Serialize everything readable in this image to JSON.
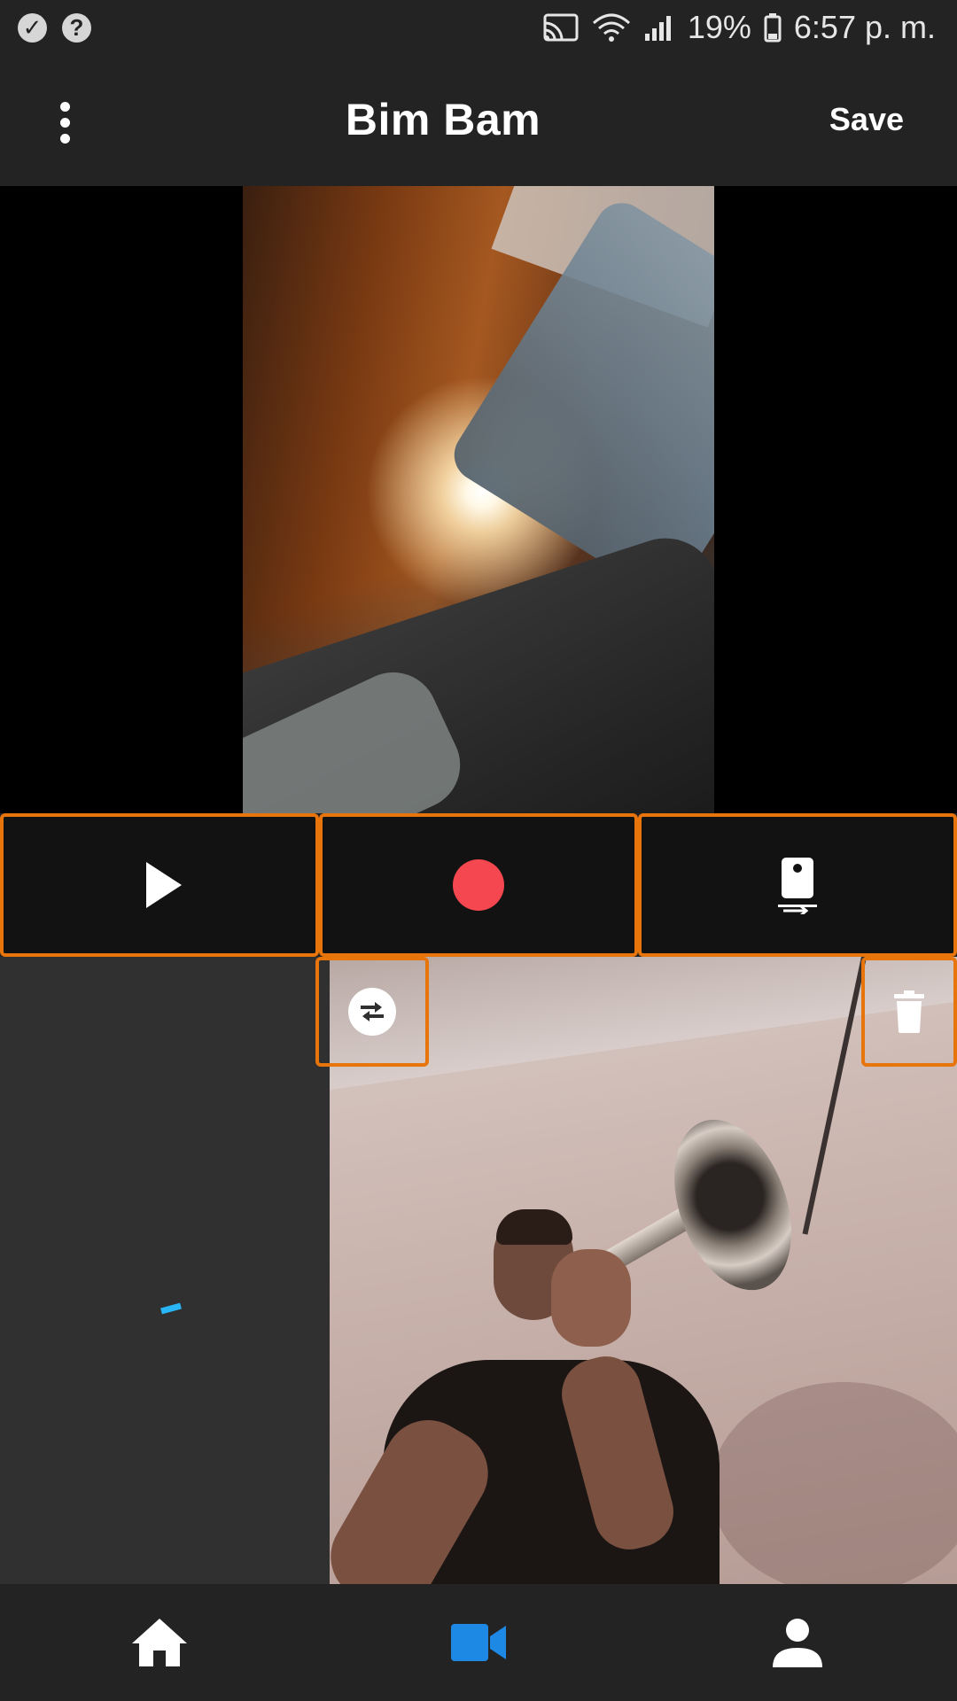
{
  "status_bar": {
    "left_icons": [
      "check-circle-icon",
      "help-circle-icon"
    ],
    "right_icons": [
      "cast-icon",
      "wifi-icon",
      "signal-icon",
      "battery-icon"
    ],
    "battery": "19%",
    "time": "6:57 p. m."
  },
  "app_bar": {
    "menu_icon": "more-vert-icon",
    "title": "Bim Bam",
    "save_label": "Save"
  },
  "controls": {
    "play_icon": "play-icon",
    "record_icon": "record-icon",
    "switch_camera_icon": "switch-camera-icon"
  },
  "bottom_panel": {
    "swap_icon": "swap-icon",
    "delete_icon": "trash-icon",
    "loading_indicator": "spinner"
  },
  "bottom_nav": {
    "items": [
      {
        "icon": "home-icon",
        "active": false
      },
      {
        "icon": "videocam-icon",
        "active": true
      },
      {
        "icon": "person-icon",
        "active": false
      }
    ]
  },
  "colors": {
    "accent_orange": "#e8740c",
    "record_red": "#f4474f",
    "active_blue": "#1e88e5",
    "spinner_blue": "#29b6f6",
    "background": "#232323"
  }
}
